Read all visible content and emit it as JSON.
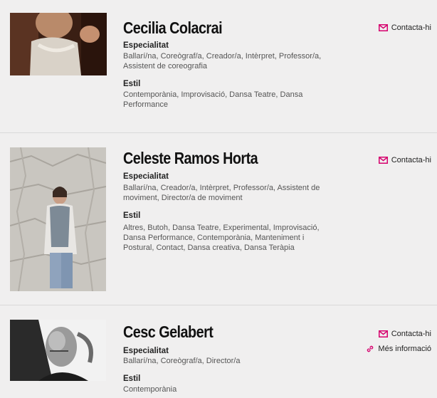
{
  "accent": "#d6006e",
  "labels": {
    "specialty": "Especialitat",
    "style": "Estil",
    "contact": "Contacta-hi",
    "more_info": "Més informació"
  },
  "icons": {
    "contact": "envelope-icon",
    "more_info": "link-icon"
  },
  "people": [
    {
      "name": "Cecilia Colacrai",
      "specialty": "Ballarí/na, Coreògraf/a, Creador/a, Intèrpret, Professor/a, Assistent de coreografia",
      "style": "Contemporània, Improvisació, Dansa Teatre, Dansa Performance"
    },
    {
      "name": "Celeste Ramos Horta",
      "specialty": "Ballarí/na, Creador/a, Intèrpret, Professor/a, Assistent de moviment, Director/a de moviment",
      "style": "Altres, Butoh, Dansa Teatre, Experimental, Improvisació, Dansa Performance, Contemporània, Manteniment i Postural, Contact, Dansa creativa, Dansa Teràpia"
    },
    {
      "name": "Cesc Gelabert",
      "specialty": "Ballarí/na, Coreògraf/a, Director/a",
      "style": "Contemporània"
    }
  ]
}
